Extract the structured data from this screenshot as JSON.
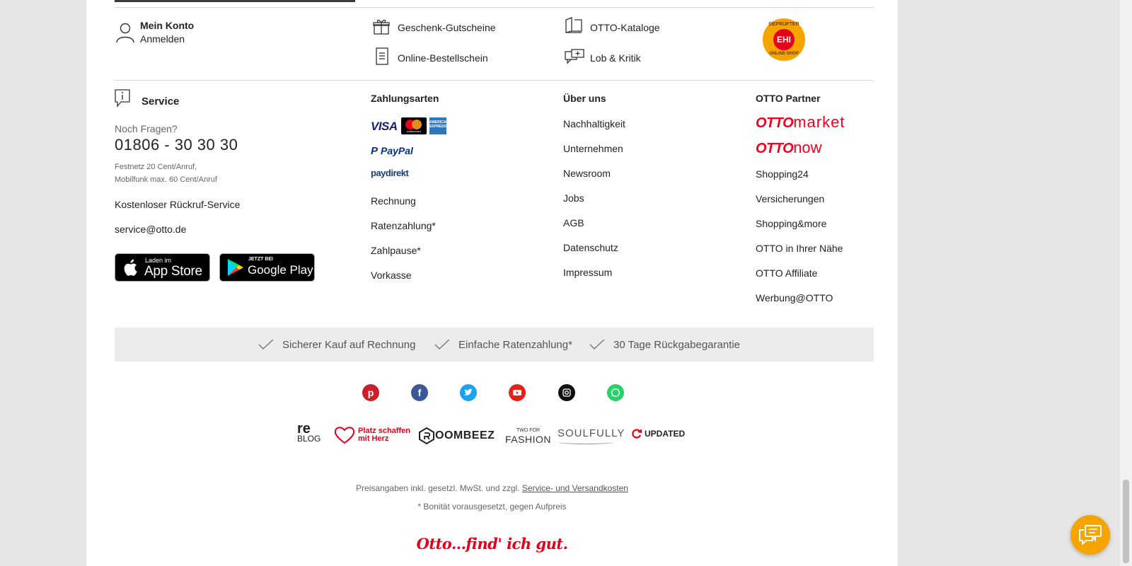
{
  "account": {
    "title": "Mein Konto",
    "login": "Anmelden"
  },
  "top_links": [
    "Geschenk-Gutscheine",
    "Online-Bestellschein",
    "OTTO-Kataloge",
    "Lob & Kritik"
  ],
  "ehi_badge": {
    "top_text": "GEPRÜFTER",
    "center_text": "EHI",
    "bottom_text": "ONLINE-SHOP"
  },
  "service": {
    "heading": "Service",
    "question": "Noch Fragen?",
    "phone": "01806 - 30 30 30",
    "fee_line1": "Festnetz 20 Cent/Anruf,",
    "fee_line2": "Mobilfunk max. 60 Cent/Anruf",
    "callback": "Kostenloser Rückruf-Service",
    "email": "service@otto.de",
    "appstore_small": "Laden im",
    "appstore_big": "App Store",
    "googleplay_small": "JETZT BEI",
    "googleplay_big": "Google Play"
  },
  "payment": {
    "heading": "Zahlungsarten",
    "logos": {
      "visa": "VISA",
      "paypal": "PayPal",
      "paydirekt": "paydirekt",
      "amex": "AMERICAN EXPRESS",
      "mastercard": "mastercard"
    },
    "items": [
      "Rechnung",
      "Ratenzahlung*",
      "Zahlpause*",
      "Vorkasse"
    ]
  },
  "about": {
    "heading": "Über uns",
    "items": [
      "Nachhaltigkeit",
      "Unternehmen",
      "Newsroom",
      "Jobs",
      "AGB",
      "Datenschutz",
      "Impressum"
    ]
  },
  "partner": {
    "heading": "OTTO Partner",
    "market_logo_a": "OTTO",
    "market_logo_b": "market",
    "now_logo_a": "OTTO",
    "now_logo_b": "now",
    "items": [
      "Shopping24",
      "Versicherungen",
      "Shopping&more",
      "OTTO in Ihrer Nähe",
      "OTTO Affiliate",
      "Werbung@OTTO"
    ]
  },
  "trust": [
    "Sicherer Kauf auf Rechnung",
    "Einfache Ratenzahlung*",
    "30 Tage Rückgabegarantie"
  ],
  "social": [
    "pinterest",
    "facebook",
    "twitter",
    "youtube",
    "instagram",
    "whatsapp"
  ],
  "brands": {
    "reblog_a": "re",
    "reblog_b": "BLOG",
    "platz_a": "Platz schaffen",
    "platz_b": "mit Herz",
    "roombeez": "OOMBEEZ",
    "twofor_small": "TWO FOR",
    "twofor_big": "FASHION",
    "soulfully": "SOULFULLY",
    "updated": "UPDATED"
  },
  "fineprint": {
    "prices": "Preisangaben inkl. gesetzl. MwSt. und zzgl.",
    "shipping_link": "Service- und Versandkosten",
    "credit": "* Bonität vorausgesetzt, gegen Aufpreis"
  },
  "slogan": "Otto...find' ich gut.",
  "colors": {
    "otto_red": "#f00020",
    "chat_orange": "#f5a400",
    "facebook": "#3b5998",
    "twitter": "#1da1f2"
  }
}
